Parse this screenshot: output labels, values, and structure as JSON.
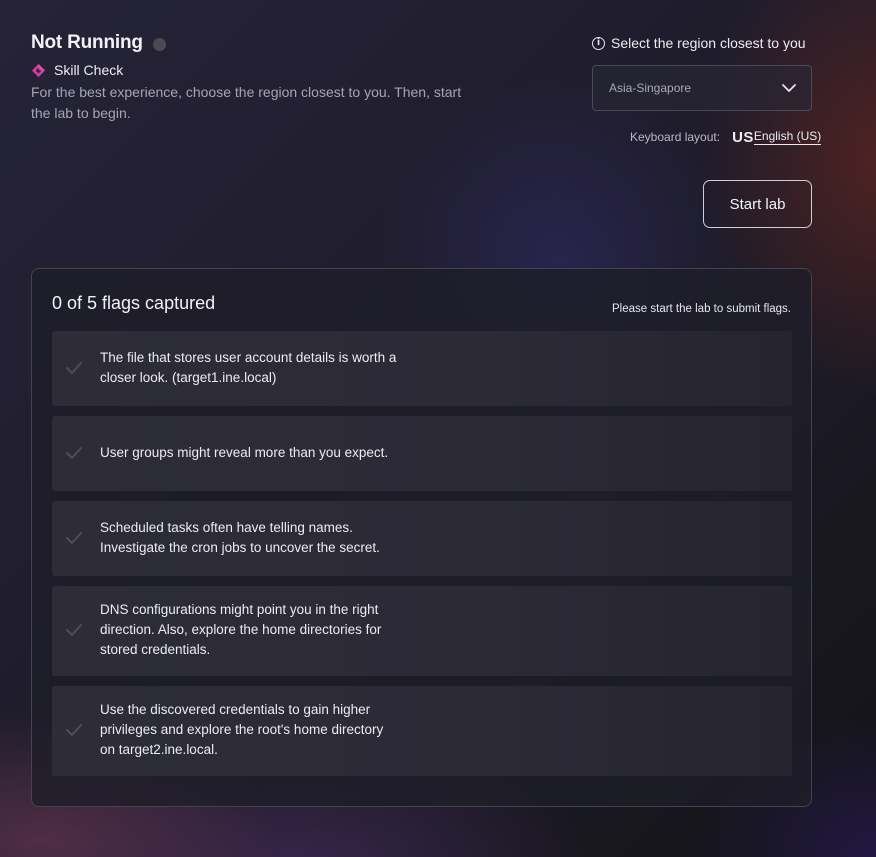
{
  "status": {
    "title": "Not Running",
    "dot_color": "#4a4a52"
  },
  "lab": {
    "type_label": "Skill Check",
    "type_icon": "diamond-icon",
    "accent_color": "#d63aa4",
    "intro": "For the best experience, choose the region closest to you. Then, start the lab to begin."
  },
  "region": {
    "label": "Select the region closest to you",
    "label_icon": "info-icon",
    "selected": "Asia-Singapore"
  },
  "keyboard": {
    "label": "Keyboard layout:",
    "code": "US",
    "language": "English (US)"
  },
  "actions": {
    "start_label": "Start lab"
  },
  "flags": {
    "title": "0 of 5 flags captured",
    "note": "Please start the lab to submit flags.",
    "items": [
      {
        "text": "The file that stores user account details is worth a closer look. (target1.ine.local)",
        "captured": false
      },
      {
        "text": "User groups might reveal more than you expect.",
        "captured": false
      },
      {
        "text": "Scheduled tasks often have telling names. Investigate the cron jobs to uncover the secret.",
        "captured": false
      },
      {
        "text": "DNS configurations might point you in the right direction. Also, explore the home directories for stored credentials.",
        "captured": false
      },
      {
        "text": "Use the discovered credentials to gain higher privileges and explore the root's home directory on target2.ine.local.",
        "captured": false
      }
    ]
  }
}
